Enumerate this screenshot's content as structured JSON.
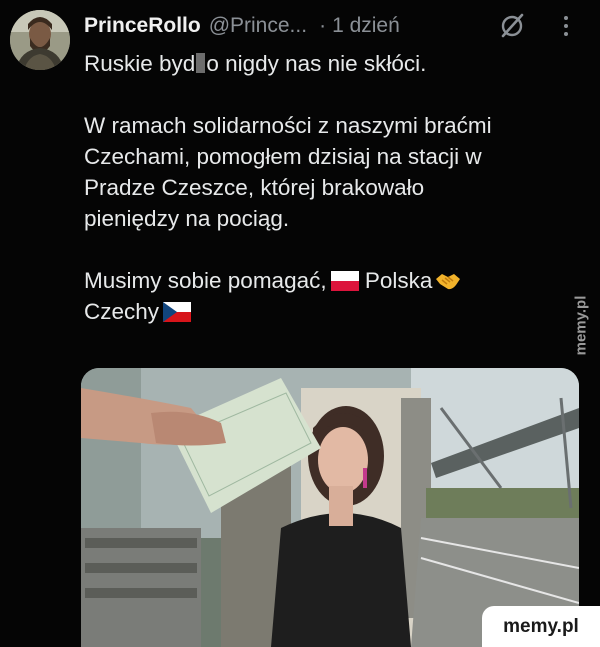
{
  "tweet": {
    "display_name": "PrinceRollo",
    "handle": "@Prince...",
    "separator": "·",
    "time": "1 dzień",
    "line1_before": "Ruskie byd",
    "line1_after": "o nigdy nas nie skłóci.",
    "para2": [
      "W ramach solidarności z naszymi braćmi",
      "Czechami, pomogłem dzisiaj na stacji w",
      "Pradze Czeszce, której brakowało",
      "pieniędzy na pociąg."
    ],
    "line3_a": "Musimy sobie pomagać,",
    "line3_b": "Polska",
    "line4": "Czechy"
  },
  "icons": {
    "grok": "grok-slash-icon",
    "more": "more-vertical-icon",
    "flag_pl": "poland-flag-icon",
    "handshake": "handshake-icon",
    "flag_cz": "czech-flag-icon"
  },
  "colors": {
    "background": "#050505",
    "text": "#e7e9ea",
    "muted": "#8b9096"
  },
  "watermarks": {
    "side": "memy.pl",
    "bottom": "memy.pl"
  }
}
